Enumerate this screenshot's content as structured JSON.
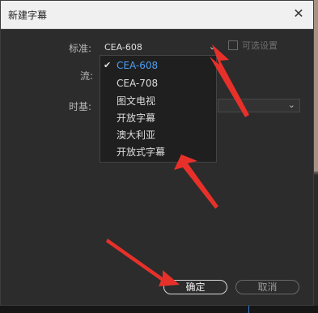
{
  "window": {
    "title": "新建字幕",
    "close_glyph": "✕"
  },
  "form": {
    "standard_label": "标准:",
    "standard_value": "CEA-608",
    "stream_label": "流:",
    "timebase_label": "时基:",
    "checkbox_label": "可选设置"
  },
  "dropdown": {
    "options": [
      {
        "label": "CEA-608",
        "selected": true
      },
      {
        "label": "CEA-708",
        "selected": false
      },
      {
        "label": "图文电视",
        "selected": false
      },
      {
        "label": "开放字幕",
        "selected": false
      },
      {
        "label": "澳大利亚",
        "selected": false
      },
      {
        "label": "开放式字幕",
        "selected": false
      }
    ],
    "check_glyph": "✔"
  },
  "buttons": {
    "ok": "确定",
    "cancel": "取消"
  },
  "colors": {
    "annotation_arrow": "#e8302a",
    "selected_option": "#4f9ef2",
    "titlebar": "#f0f0f0"
  },
  "icons": {
    "chevron": "chevron-down-icon",
    "close": "close-icon"
  }
}
